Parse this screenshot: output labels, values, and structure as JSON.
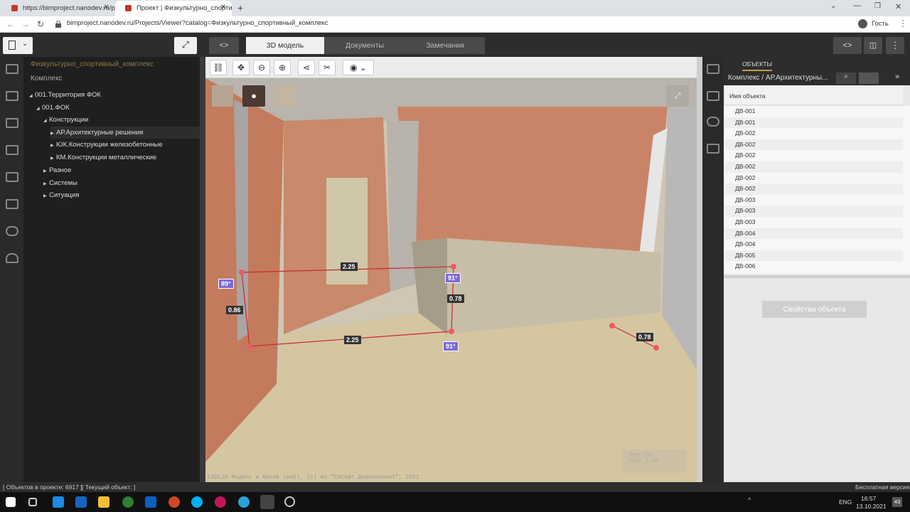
{
  "browser": {
    "tabs": [
      {
        "title": "https://bimproject.nanodev.ru/p"
      },
      {
        "title": "Проект | Физкультурно_спортив"
      }
    ],
    "url": "bimproject.nanodev.ru/Projects/Viewer?catalog=Физкультурно_спортивный_комплекс",
    "profile_label": "Гость"
  },
  "view_tabs": [
    "3D модель",
    "Документы",
    "Замечания"
  ],
  "tree": {
    "project_title": "Физкультурно_спортивный_комплекс",
    "root_label": "Комплекс",
    "items": [
      {
        "label": "001.Территория ФОК"
      },
      {
        "label": "001.ФОК"
      },
      {
        "label": "Конструкции"
      },
      {
        "label": "АР.Архитектурные решения"
      },
      {
        "label": "ЮК.Конструкции железобетонные"
      },
      {
        "label": "КМ.Конструкции металлические"
      },
      {
        "label": "Разное"
      },
      {
        "label": "Системы"
      },
      {
        "label": "Ситуация"
      }
    ]
  },
  "viewer": {
    "measurements": [
      "2.25",
      "0.86",
      "0.78",
      "2.25",
      "0.78"
    ],
    "angles": [
      "89°",
      "91°",
      "91°"
    ],
    "copyright": "CADLib Модель и Архив (веб), (c) АО \"СиСофт Девелопмент\", 2021",
    "stats_line1": "383 (7%)",
    "stats_line2": "FPS: 2.00"
  },
  "objects": {
    "tab_label": "ОБЪЕКТЫ",
    "path": "Комплекс / АР.Архитектурны...",
    "column_header": "Имя объекта",
    "rows": [
      "ДВ-001",
      "ДВ-001",
      "ДВ-002",
      "ДВ-002",
      "ДВ-002",
      "ДВ-002",
      "ДВ-002",
      "ДВ-002",
      "ДВ-003",
      "ДВ-003",
      "ДВ-003",
      "ДВ-004",
      "ДВ-004",
      "ДВ-005",
      "ДВ-006"
    ],
    "properties_button": "Свойства объекта"
  },
  "status": {
    "objects_count": "[ Объектов в проекте: 6917 ]",
    "current_object": "[ Текущий объект: ]",
    "version": "Бесплатная версия"
  },
  "taskbar": {
    "lang": "ENG",
    "time": "16:57",
    "date": "13.10.2021",
    "notif_count": "43"
  }
}
